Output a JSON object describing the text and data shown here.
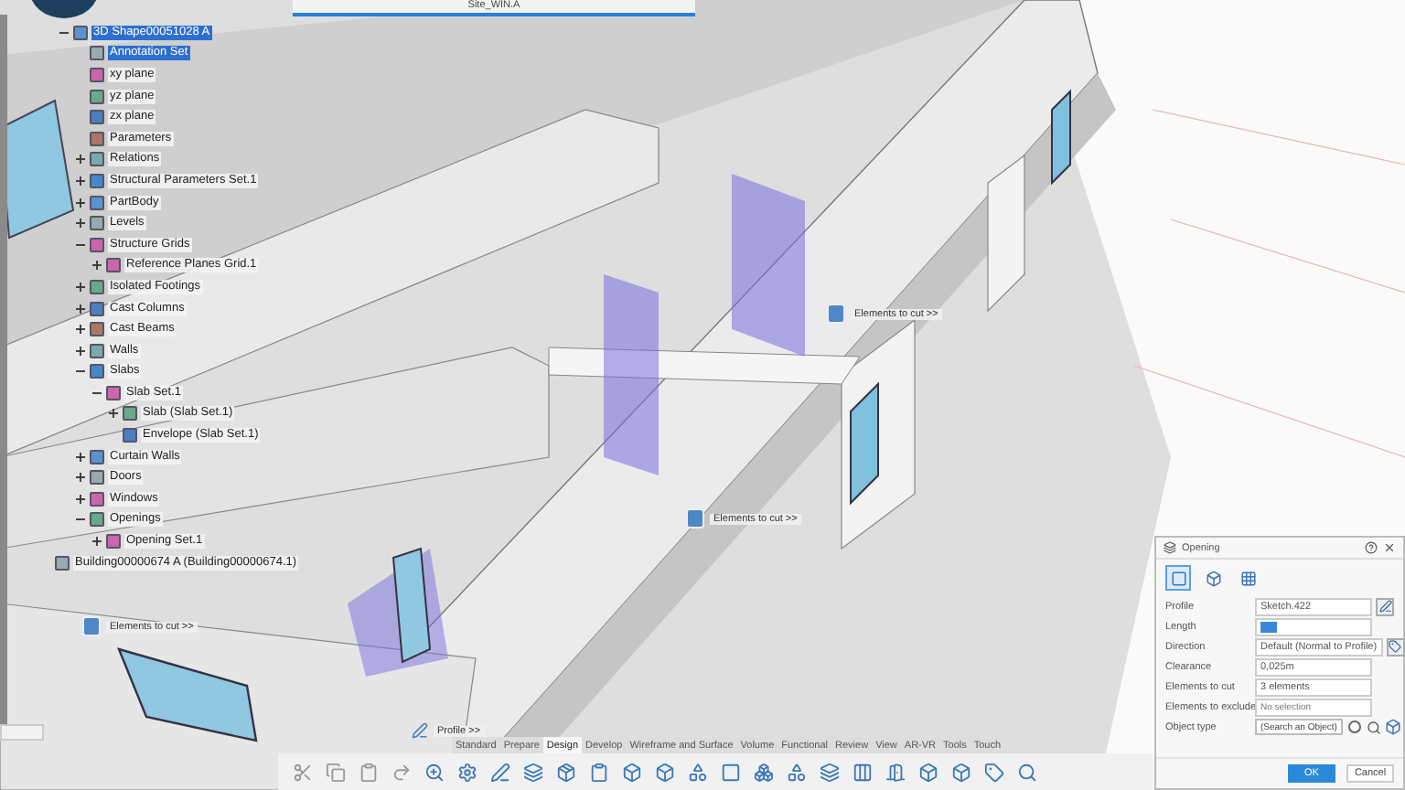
{
  "document_tab": {
    "title": "Site_WIN.A"
  },
  "tree": {
    "items": [
      {
        "label": "3D Shape00051028 A",
        "kind": "part",
        "selected": true,
        "expanded": true,
        "children": [
          {
            "label": "Annotation Set",
            "selected": true
          },
          {
            "label": "xy plane",
            "selected": false
          },
          {
            "label": "yz plane",
            "selected": false
          },
          {
            "label": "zx plane",
            "selected": false
          },
          {
            "label": "Parameters",
            "selected": false
          },
          {
            "label": "Relations",
            "selected": false,
            "expanded": false
          },
          {
            "label": "Structural Parameters Set.1",
            "selected": false,
            "expanded": false
          },
          {
            "label": "PartBody",
            "selected": false,
            "expanded": false
          },
          {
            "label": "Levels",
            "selected": false,
            "expanded": false
          },
          {
            "label": "Structure Grids",
            "selected": false,
            "expanded": true,
            "children": [
              {
                "label": "Reference Planes Grid.1",
                "selected": false,
                "expanded": false
              }
            ]
          },
          {
            "label": "Isolated Footings",
            "selected": false,
            "expanded": false
          },
          {
            "label": "Cast Columns",
            "selected": false,
            "expanded": false
          },
          {
            "label": "Cast Beams",
            "selected": false,
            "expanded": false
          },
          {
            "label": "Walls",
            "selected": false,
            "expanded": false
          },
          {
            "label": "Slabs",
            "selected": false,
            "expanded": true,
            "children": [
              {
                "label": "Slab Set.1",
                "selected": false,
                "expanded": true,
                "children": [
                  {
                    "label": "Slab (Slab Set.1)",
                    "selected": false,
                    "expanded": false
                  },
                  {
                    "label": "Envelope (Slab Set.1)",
                    "selected": false
                  }
                ]
              }
            ]
          },
          {
            "label": "Curtain Walls",
            "selected": false,
            "expanded": false
          },
          {
            "label": "Doors",
            "selected": false,
            "expanded": false
          },
          {
            "label": "Windows",
            "selected": false,
            "expanded": false
          },
          {
            "label": "Openings",
            "selected": false,
            "expanded": true,
            "children": [
              {
                "label": "Opening Set.1",
                "selected": false,
                "expanded": false
              }
            ]
          }
        ]
      },
      {
        "label": "Building00000674 A (Building00000674.1)",
        "kind": "product",
        "selected": false
      }
    ]
  },
  "canvas_labels": [
    {
      "text": "Elements to cut >>",
      "kind": "elements"
    },
    {
      "text": "Elements to cut >>",
      "kind": "elements"
    },
    {
      "text": "Elements to cut >>",
      "kind": "elements"
    },
    {
      "text": "Profile >>",
      "kind": "profile"
    }
  ],
  "dialog": {
    "title": "Opening",
    "mode_tabs": [
      {
        "kind": "profile",
        "selected": true
      },
      {
        "kind": "solid",
        "selected": false
      },
      {
        "kind": "pattern",
        "selected": false
      }
    ],
    "rows": [
      {
        "label": "Profile",
        "kind": "select",
        "value": "Sketch.422",
        "tool": {
          "kind": "edit"
        }
      },
      {
        "label": "Length",
        "kind": "spin",
        "selected_text": true
      },
      {
        "label": "Direction",
        "kind": "select",
        "value": "Default (Normal to Profile)",
        "tool": {
          "kind": "direction"
        }
      },
      {
        "label": "Clearance",
        "kind": "spin",
        "value": "0,025m"
      },
      {
        "label": "Elements to cut",
        "kind": "list",
        "value": "3 elements"
      },
      {
        "label": "Elements to exclude",
        "kind": "list",
        "placeholder": "No selection"
      },
      {
        "label": "Object type",
        "kind": "search",
        "value": "(Search an Object)",
        "option": {
          "selected": false
        }
      }
    ],
    "buttons": [
      {
        "label": "OK",
        "kind": "primary"
      },
      {
        "label": "Cancel",
        "kind": "secondary"
      }
    ]
  },
  "toolbar": {
    "tabs": [
      {
        "label": "Standard",
        "selected": false
      },
      {
        "label": "Prepare",
        "selected": false
      },
      {
        "label": "Design",
        "selected": true
      },
      {
        "label": "Develop",
        "selected": false
      },
      {
        "label": "Wireframe and Surface",
        "selected": false
      },
      {
        "label": "Volume",
        "selected": false
      },
      {
        "label": "Functional",
        "selected": false
      },
      {
        "label": "Review",
        "selected": false
      },
      {
        "label": "View",
        "selected": false
      },
      {
        "label": "AR-VR",
        "selected": false
      },
      {
        "label": "Tools",
        "selected": false
      },
      {
        "label": "Touch",
        "selected": false
      }
    ]
  }
}
